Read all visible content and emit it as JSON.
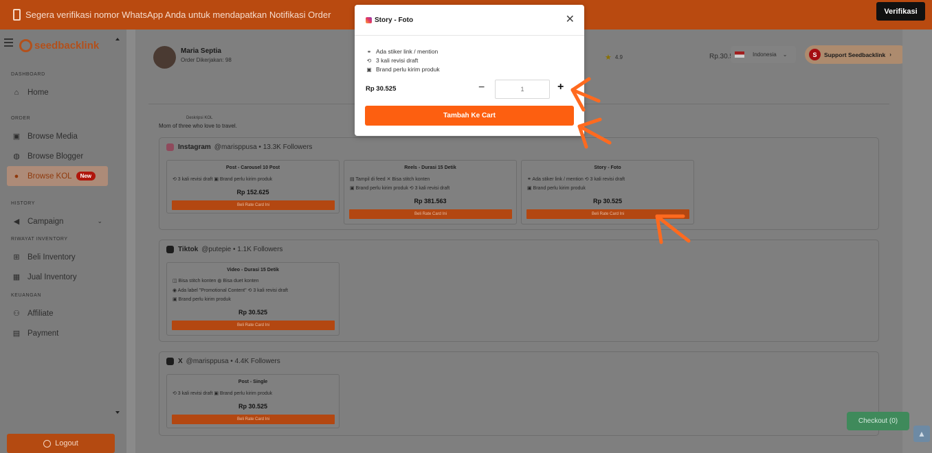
{
  "banner": {
    "message": "Segera verifikasi nomor WhatsApp Anda untuk mendapatkan Notifikasi Order",
    "verify_label": "Verifikasi"
  },
  "sidebar": {
    "brand": "seedbacklink",
    "sections": {
      "dashboard": "DASHBOARD",
      "order": "ORDER",
      "history": "HISTORY",
      "inventory": "RIWAYAT INVENTORY",
      "finance": "KEUANGAN"
    },
    "items": {
      "home": "Home",
      "browse_media": "Browse Media",
      "browse_blogger": "Browse Blogger",
      "browse_kol": "Browse KOL",
      "new_badge": "New",
      "campaign": "Campaign",
      "beli_inventory": "Beli Inventory",
      "jual_inventory": "Jual Inventory",
      "affiliate": "Affiliate",
      "payment": "Payment"
    },
    "logout": "Logout"
  },
  "header": {
    "user_name": "Maria Septia",
    "orders_done": "Order Dikerjakan: 98",
    "rating": "4.9",
    "price_partial": "Rp.30.5",
    "language": "Indonesia",
    "support_initial": "S",
    "support_label": "Support Seedbacklink"
  },
  "profile": {
    "desc_label": "Deskripsi KOL",
    "desc_text": "Mom of three who love to travel."
  },
  "platforms": {
    "instagram": {
      "name": "Instagram",
      "meta": "@marisppusa • 13.3K Followers",
      "cards": [
        {
          "title": "Post - Carousel 10 Post",
          "features": [
            "⟲ 3 kali revisi draft  ▣ Brand perlu kirim produk"
          ],
          "price": "Rp 152.625",
          "button": "Beli Rate Card Ini"
        },
        {
          "title": "Reels - Durasi 15 Detik",
          "features": [
            "▤ Tampil di feed  ✕ Bisa stitch konten",
            "▣ Brand perlu kirim produk  ⟲ 3 kali revisi draft"
          ],
          "price": "Rp 381.563",
          "button": "Beli Rate Card Ini"
        },
        {
          "title": "Story - Foto",
          "features": [
            "⚭ Ada stiker link / mention  ⟲ 3 kali revisi draft",
            "▣ Brand perlu kirim produk"
          ],
          "price": "Rp 30.525",
          "button": "Beli Rate Card Ini"
        }
      ]
    },
    "tiktok": {
      "name": "Tiktok",
      "meta": "@putepie • 1.1K Followers",
      "cards": [
        {
          "title": "Video - Durasi 15 Detik",
          "features": [
            "◫ Bisa stitch konten  ◍ Bisa duet konten",
            "◉ Ada label \"Promotional Content\"  ⟲ 3 kali revisi draft",
            "▣ Brand perlu kirim produk"
          ],
          "price": "Rp 30.525",
          "button": "Beli Rate Card Ini"
        }
      ]
    },
    "x": {
      "name": "X",
      "meta": "@marisppusa • 4.4K Followers",
      "cards": [
        {
          "title": "Post - Single",
          "features": [
            "⟲ 3 kali revisi draft  ▣ Brand perlu kirim produk"
          ],
          "price": "Rp 30.525",
          "button": "Beli Rate Card Ini"
        }
      ]
    }
  },
  "checkout_label": "Checkout (0)",
  "modal": {
    "title": "Story - Foto",
    "features": [
      "Ada stiker link / mention",
      "3 kali revisi draft",
      "Brand perlu kirim produk"
    ],
    "price": "Rp 30.525",
    "quantity_placeholder": "1",
    "add_to_cart": "Tambah Ke Cart"
  },
  "colors": {
    "accent": "#fd5f10",
    "banner": "#b94a10",
    "checkout": "#3f8a5b"
  }
}
